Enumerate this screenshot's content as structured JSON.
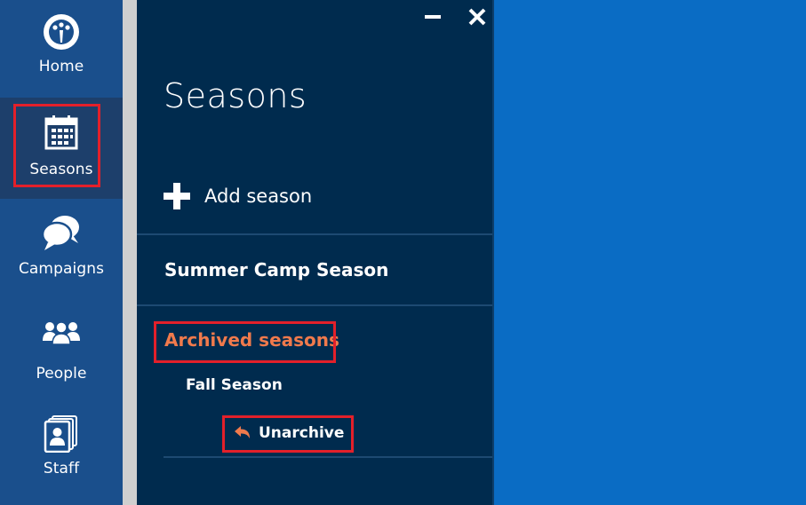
{
  "nav": {
    "items": [
      {
        "label": "Home",
        "icon": "home-dial-icon"
      },
      {
        "label": "Seasons",
        "icon": "calendar-icon",
        "active": true
      },
      {
        "label": "Campaigns",
        "icon": "chat-bubbles-icon"
      },
      {
        "label": "People",
        "icon": "people-group-icon"
      },
      {
        "label": "Staff",
        "icon": "staff-cards-icon"
      }
    ]
  },
  "panel": {
    "title": "Seasons",
    "add_label": "Add season",
    "seasons": [
      "Summer Camp Season"
    ],
    "archived_title": "Archived seasons",
    "archived_items": [
      {
        "name": "Fall Season",
        "action_label": "Unarchive",
        "action_icon": "undo-arrow-icon"
      }
    ]
  },
  "colors": {
    "nav_bg": "#1a4f8c",
    "nav_active_bg": "#1d3f6b",
    "panel_bg": "#002b4e",
    "desktop_bg": "#0a6cc4",
    "accent_orange": "#f07a4c",
    "highlight_red": "#e3202a"
  }
}
